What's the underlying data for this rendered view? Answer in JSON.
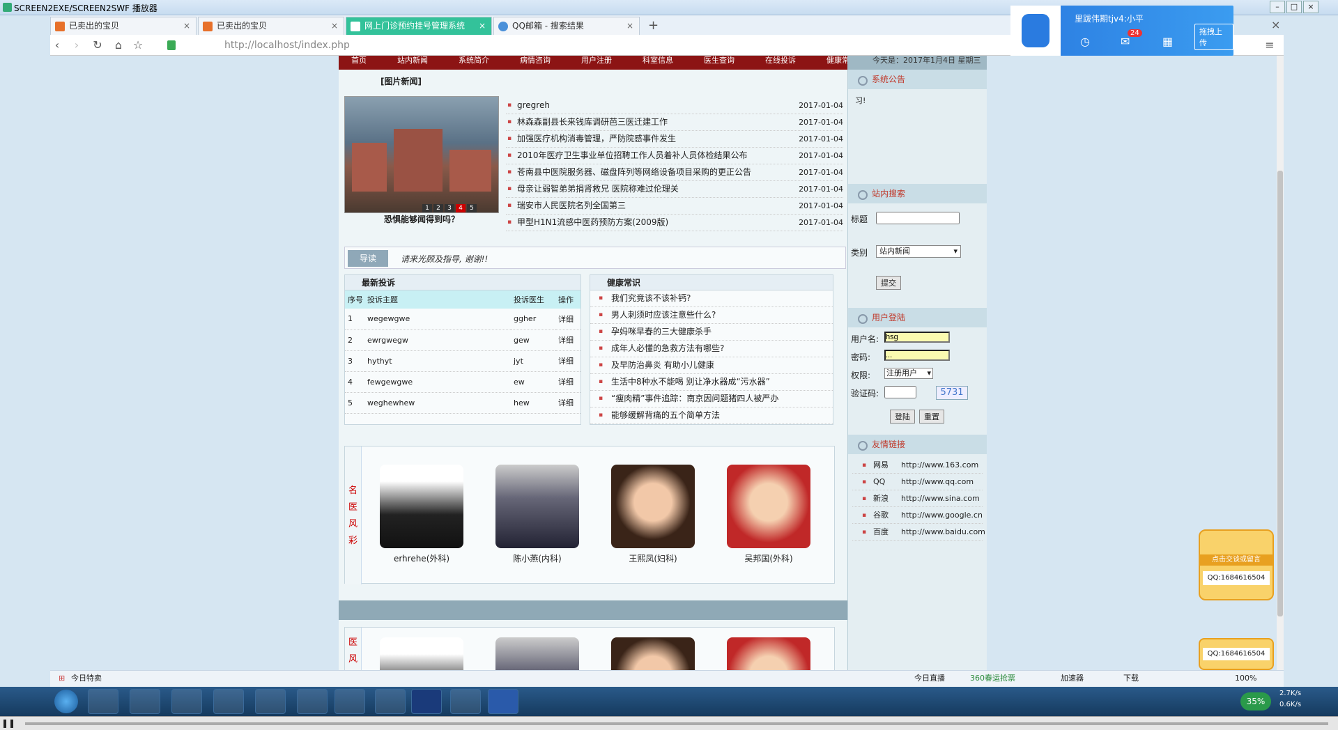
{
  "window": {
    "title": "SCREEN2EXE/SCREEN2SWF 播放器"
  },
  "tabs": [
    {
      "label": "已卖出的宝贝"
    },
    {
      "label": "已卖出的宝贝"
    },
    {
      "label": "网上门诊预约挂号管理系统"
    },
    {
      "label": "QQ邮箱 - 搜索结果"
    }
  ],
  "address": {
    "url": "http://localhost/index.php"
  },
  "notification": {
    "name": "里跋伟期tjv4:小平",
    "badge": "24",
    "upload": "拖拽上传"
  },
  "site": {
    "nav": [
      "首页",
      "站内新闻",
      "系统简介",
      "病情咨询",
      "用户注册",
      "科室信息",
      "医生查询",
      "在线投诉",
      "健康常识"
    ],
    "date": "今天是：2017年1月4日 星期三",
    "picnews_title": "[图片新闻]",
    "pic_caption": "恐惧能够闻得到吗？",
    "pic_numbers": [
      "1",
      "2",
      "3",
      "4",
      "5"
    ],
    "news": [
      {
        "title": "gregreh",
        "date": "2017-01-04"
      },
      {
        "title": "林森森副县长来钱库调研芭三医迁建工作",
        "date": "2017-01-04"
      },
      {
        "title": "加强医疗机构消毒管理，严防院感事件发生",
        "date": "2017-01-04"
      },
      {
        "title": "2010年医疗卫生事业单位招聘工作人员着补人员体检结果公布",
        "date": "2017-01-04"
      },
      {
        "title": "苍南县中医院服务器、磁盘阵列等网络设备项目采购的更正公告",
        "date": "2017-01-04"
      },
      {
        "title": "母亲让弱智弟弟捐肾救兄 医院称难过伦理关",
        "date": "2017-01-04"
      },
      {
        "title": "瑞安市人民医院名列全国第三",
        "date": "2017-01-04"
      },
      {
        "title": "甲型H1N1流感中医药预防方案(2009版)",
        "date": "2017-01-04"
      }
    ],
    "guide_label": "导读",
    "guide_text": "请来光顾及指导, 谢谢!!",
    "complaints_title": "最新投诉",
    "complaints_headers": [
      "序号",
      "投诉主题",
      "投诉医生",
      "操作"
    ],
    "complaints": [
      {
        "no": "1",
        "topic": "wegewgwe",
        "doctor": "ggher",
        "op": "详细"
      },
      {
        "no": "2",
        "topic": "ewrgwegw",
        "doctor": "gew",
        "op": "详细"
      },
      {
        "no": "3",
        "topic": "hythyt",
        "doctor": "jyt",
        "op": "详细"
      },
      {
        "no": "4",
        "topic": "fewgewgwe",
        "doctor": "ew",
        "op": "详细"
      },
      {
        "no": "5",
        "topic": "weghewhew",
        "doctor": "hew",
        "op": "详细"
      }
    ],
    "health_title": "健康常识",
    "health": [
      "我们究竟该不该补钙?",
      "男人刺须时应该注意些什么?",
      "孕妈咪早春的三大健康杀手",
      "成年人必懂的急救方法有哪些?",
      "及早防治鼻炎 有助小儿健康",
      "生活中8种水不能喝 别让净水器成“污水器”",
      "“瘦肉精”事件追踪：南京因问题猪四人被严办",
      "能够缓解背痛的五个简单方法"
    ],
    "doctors_label": [
      "名",
      "医",
      "风",
      "彩"
    ],
    "doctors": [
      {
        "name": "erhrehe(外科)"
      },
      {
        "name": "陈小燕(内科)"
      },
      {
        "name": "王熙凤(妇科)"
      },
      {
        "name": "吴邦国(外科)"
      }
    ],
    "notice_title": "系统公告",
    "notice_text": "习!",
    "search_title": "站内搜索",
    "search_label_title": "标题",
    "search_label_type": "类别",
    "search_type_value": "站内新闻",
    "search_submit": "提交",
    "login_title": "用户登陆",
    "login_user_label": "用户名:",
    "login_user_value": "hsg",
    "login_pwd_label": "密码:",
    "login_pwd_value": "...",
    "login_role_label": "权限:",
    "login_role_value": "注册用户",
    "login_code_label": "验证码:",
    "login_code": "5731",
    "login_btn": "登陆",
    "reset_btn": "重置",
    "links_title": "友情链接",
    "links": [
      {
        "name": "网易",
        "url": "http://www.163.com"
      },
      {
        "name": "QQ",
        "url": "http://www.qq.com"
      },
      {
        "name": "新浪",
        "url": "http://www.sina.com"
      },
      {
        "name": "谷歌",
        "url": "http://www.google.cn"
      },
      {
        "name": "百度",
        "url": "http://www.baidu.com"
      }
    ],
    "qq_click": "点击交谈或留言",
    "qq_number": "QQ:1684616504"
  },
  "statusbar": {
    "left": "今日特卖",
    "live": "今日直播",
    "deals": "360春运抢票",
    "accel": "加速器",
    "download": "下载",
    "zoom": "100%"
  },
  "tray": {
    "up": "2.7K/s",
    "down": "0.6K/s",
    "percent": "35%"
  }
}
